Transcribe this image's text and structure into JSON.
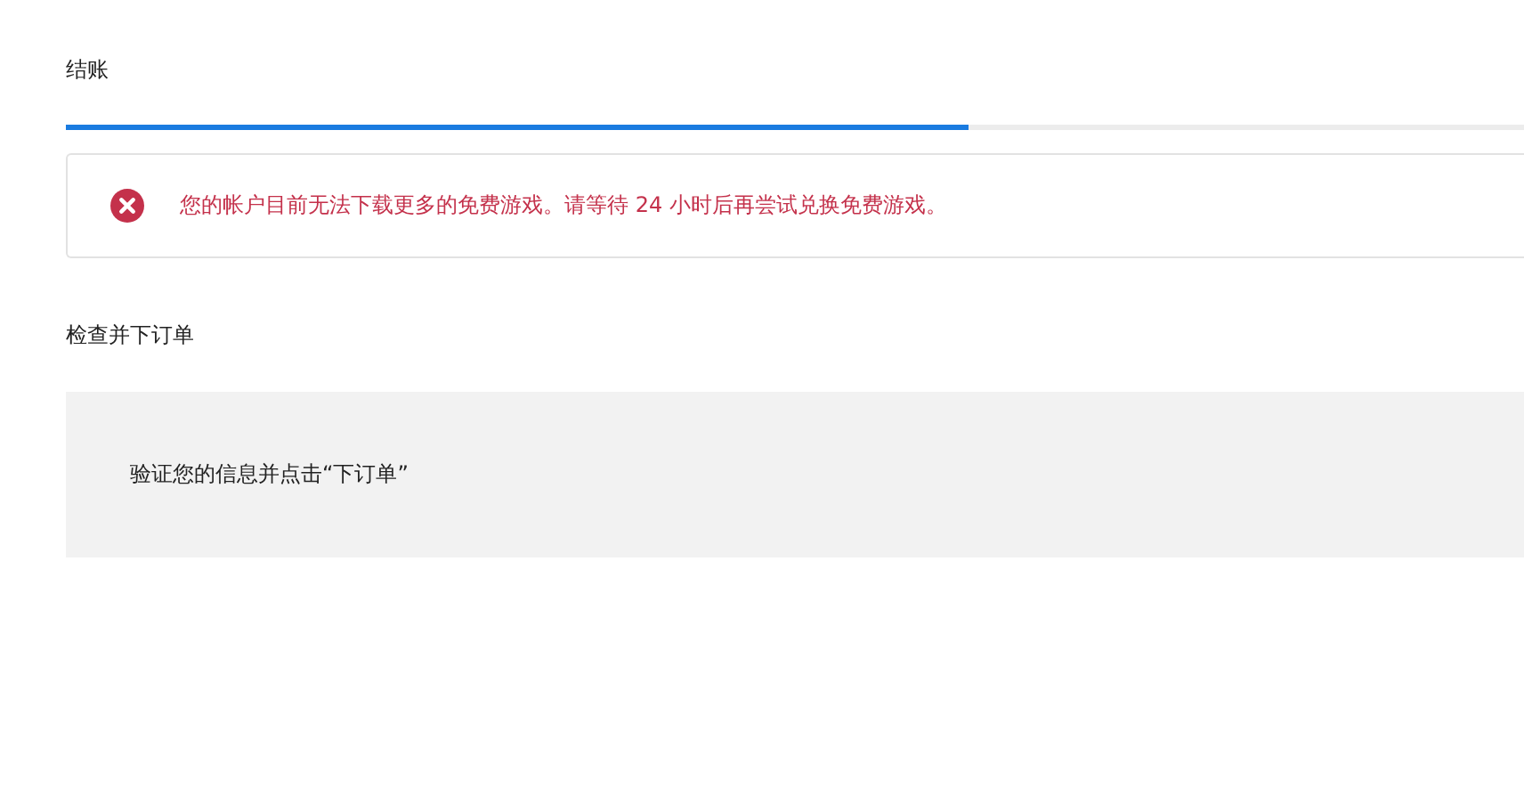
{
  "title": "结账",
  "progress": {
    "level": 0.59
  },
  "alert": {
    "kind": "error",
    "message": "您的帐户目前无法下载更多的免费游戏。请等待 24 小时后再尝试兑换免费游戏。"
  },
  "section": {
    "heading": "检查并下订单",
    "note": "验证您的信息并点击“下订单”"
  }
}
